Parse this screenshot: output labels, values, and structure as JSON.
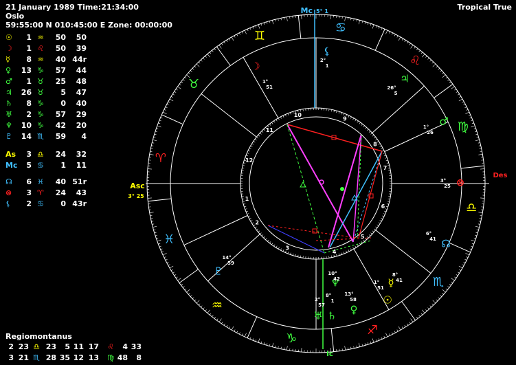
{
  "header": {
    "line1": "21 January 1989 Time:21:34:00",
    "line2": "Oslo",
    "line3": "59:55:00 N 010:45:00 E Zone: 00:00:00",
    "top_right": "Tropical True"
  },
  "planets": [
    {
      "glyph": "☉",
      "color": "#ffff00",
      "deg": "1",
      "sign": "♒",
      "scolor": "#ffff00",
      "min": "50",
      "sec": "50"
    },
    {
      "glyph": "☽",
      "color": "#ff2020",
      "deg": "1",
      "sign": "♌",
      "scolor": "#ff2020",
      "min": "50",
      "sec": "39"
    },
    {
      "glyph": "☿",
      "color": "#ffff00",
      "deg": "8",
      "sign": "♒",
      "scolor": "#ffff00",
      "min": "40",
      "sec": "44r"
    },
    {
      "glyph": "♀",
      "color": "#40ff40",
      "deg": "13",
      "sign": "♑",
      "scolor": "#40ff40",
      "min": "57",
      "sec": "44"
    },
    {
      "glyph": "♂",
      "color": "#40ff40",
      "deg": "1",
      "sign": "♉",
      "scolor": "#40ff40",
      "min": "25",
      "sec": "48"
    },
    {
      "glyph": "♃",
      "color": "#40ff40",
      "deg": "26",
      "sign": "♉",
      "scolor": "#40ff40",
      "min": "5",
      "sec": "47"
    },
    {
      "glyph": "♄",
      "color": "#40ff40",
      "deg": "8",
      "sign": "♑",
      "scolor": "#40ff40",
      "min": "0",
      "sec": "40"
    },
    {
      "glyph": "♅",
      "color": "#40ff40",
      "deg": "2",
      "sign": "♑",
      "scolor": "#40ff40",
      "min": "57",
      "sec": "29"
    },
    {
      "glyph": "♆",
      "color": "#40ff40",
      "deg": "10",
      "sign": "♑",
      "scolor": "#40ff40",
      "min": "42",
      "sec": "20"
    },
    {
      "glyph": "♇",
      "color": "#40c0ff",
      "deg": "14",
      "sign": "♏",
      "scolor": "#40c0ff",
      "min": "59",
      "sec": "4"
    },
    {
      "glyph": "As",
      "color": "#ffff00",
      "deg": "3",
      "sign": "♎",
      "scolor": "#ffff00",
      "min": "24",
      "sec": "32"
    },
    {
      "glyph": "Mc",
      "color": "#40c0ff",
      "deg": "5",
      "sign": "♋",
      "scolor": "#40c0ff",
      "min": "1",
      "sec": "11"
    },
    {
      "glyph": "☊",
      "color": "#40c0ff",
      "deg": "6",
      "sign": "♓",
      "scolor": "#40c0ff",
      "min": "40",
      "sec": "51r"
    },
    {
      "glyph": "⊗",
      "color": "#ff2020",
      "deg": "3",
      "sign": "♈",
      "scolor": "#ff2020",
      "min": "24",
      "sec": "43"
    },
    {
      "glyph": "⚸",
      "color": "#40c0ff",
      "deg": "2",
      "sign": "♋",
      "scolor": "#40c0ff",
      "min": "0",
      "sec": "43r"
    }
  ],
  "houses": {
    "title": "Regiomontanus",
    "rows": [
      {
        "n": "2",
        "deg": "23",
        "sign": "♎",
        "scolor": "#ffff00",
        "mins": "23",
        "a": "5",
        "b": "11",
        "c": "17",
        "sign2": "♌",
        "s2color": "#ff2020",
        "d": "4",
        "e": "33"
      },
      {
        "n": "3",
        "deg": "21",
        "sign": "♏",
        "scolor": "#40c0ff",
        "mins": "28",
        "a": "35",
        "b": "12",
        "c": "13",
        "sign2": "♍",
        "s2color": "#40ff40",
        "d": "48",
        "e": "8"
      }
    ]
  },
  "wheel": {
    "mc_label": "Mc",
    "mc_deg": "5° 1",
    "ic_label": "Ic",
    "asc_label": "Asc",
    "asc_deg": "3° 25",
    "des_label": "Des",
    "zodiac": [
      {
        "sym": "♋",
        "color": "#40c0ff"
      },
      {
        "sym": "♊",
        "color": "#ffff00"
      },
      {
        "sym": "♉",
        "color": "#40ff40"
      },
      {
        "sym": "♈",
        "color": "#ff2020"
      },
      {
        "sym": "♓",
        "color": "#40c0ff"
      },
      {
        "sym": "♒",
        "color": "#ffff00"
      },
      {
        "sym": "♑",
        "color": "#40ff40"
      },
      {
        "sym": "♐",
        "color": "#ff2020"
      },
      {
        "sym": "♏",
        "color": "#40c0ff"
      },
      {
        "sym": "♎",
        "color": "#ffff00"
      },
      {
        "sym": "♍",
        "color": "#40ff40"
      },
      {
        "sym": "♌",
        "color": "#ff2020"
      }
    ],
    "house_numbers": [
      "1",
      "2",
      "3",
      "4",
      "5",
      "6",
      "7",
      "8",
      "9",
      "10",
      "11",
      "12"
    ],
    "placements": [
      {
        "sym": "⚸",
        "color": "#40c0ff",
        "deg": "2°",
        "min": "1",
        "name": "lilith-glyph"
      },
      {
        "sym": "☽",
        "color": "#ff2020",
        "deg": "1°",
        "min": "51",
        "name": "moon-glyph"
      },
      {
        "sym": "♃",
        "color": "#40ff40",
        "deg": "26°",
        "min": "5",
        "name": "jupiter-glyph"
      },
      {
        "sym": "♂",
        "color": "#40ff40",
        "deg": "1°",
        "min": "26",
        "name": "mars-glyph"
      },
      {
        "sym": "⊗",
        "color": "#ff2020",
        "deg": "3°",
        "min": "25",
        "name": "fortuna-glyph"
      },
      {
        "sym": "☊",
        "color": "#40c0ff",
        "deg": "6°",
        "min": "41",
        "name": "node-glyph"
      },
      {
        "sym": "☿",
        "color": "#ffff00",
        "deg": "8°",
        "min": "41",
        "name": "mercury-glyph"
      },
      {
        "sym": "☉",
        "color": "#ffff00",
        "deg": "1°",
        "min": "51",
        "name": "sun-glyph"
      },
      {
        "sym": "♀",
        "color": "#40ff40",
        "deg": "13°",
        "min": "58",
        "name": "venus-glyph"
      },
      {
        "sym": "♆",
        "color": "#40ff40",
        "deg": "10°",
        "min": "42",
        "name": "neptune-glyph"
      },
      {
        "sym": "♄",
        "color": "#40ff40",
        "deg": "8°",
        "min": "1",
        "name": "saturn-glyph"
      },
      {
        "sym": "♅",
        "color": "#40ff40",
        "deg": "2°",
        "min": "57",
        "name": "uranus-glyph"
      },
      {
        "sym": "♇",
        "color": "#40c0ff",
        "deg": "14°",
        "min": "59",
        "name": "pluto-glyph"
      }
    ]
  },
  "colors": {
    "background": "#000000",
    "fire": "#ff2020",
    "earth": "#40ff40",
    "air": "#ffff00",
    "water": "#40c0ff",
    "aspect_magenta": "#ff40ff"
  }
}
